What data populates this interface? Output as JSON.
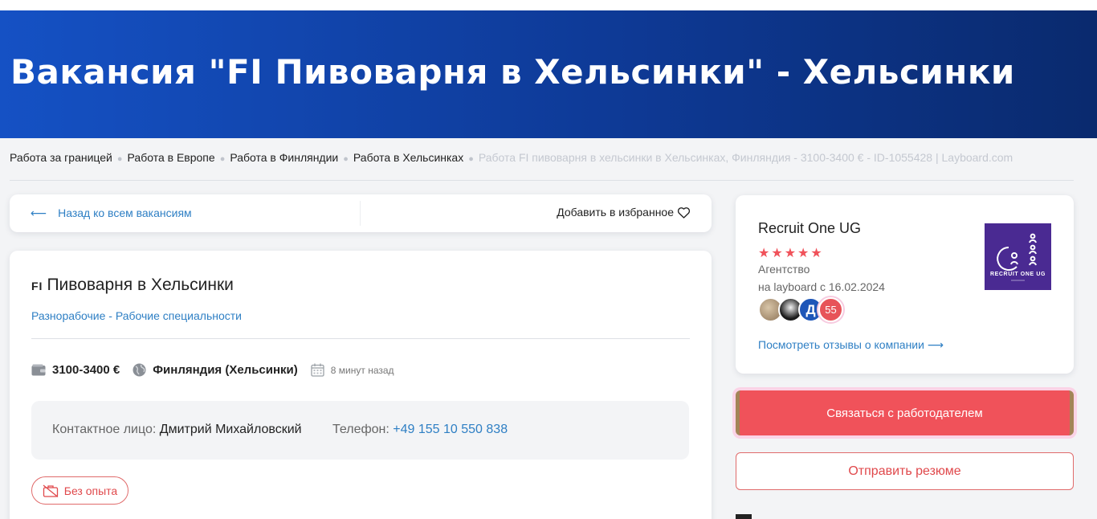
{
  "header": {
    "title": "Вакансия \"FI Пивоварня в Хельсинки\" - Хельсинки"
  },
  "breadcrumbs": {
    "items": [
      "Работа за границей",
      "Работа в Европе",
      "Работа в Финляндии",
      "Работа в Хельсинках"
    ],
    "current": "Работа FI пивоварня в хельсинки в Хельсинках, Финляндия - 3100-3400 € - ID-1055428 | Layboard.com"
  },
  "nav": {
    "back_label": "Назад ко всем вакансиям",
    "favorite_label": "Добавить в избранное"
  },
  "job": {
    "flag_code": "FI",
    "title": "Пивоварня в Хельсинки",
    "category": "Разнорабочие - Рабочие специальности",
    "salary": "3100-3400 €",
    "location": "Финляндия (Хельсинки)",
    "posted": "8 минут назад",
    "contact_label": "Контактное лицо:",
    "contact_name": "Дмитрий Михайловский",
    "phone_label": "Телефон:",
    "phone": "+49 155 10 550 838",
    "badge": "Без опыта"
  },
  "company": {
    "name": "Recruit One UG",
    "rating_stars": 5,
    "type": "Агентство",
    "since": "на layboard с 16.02.2024",
    "avatar_initial": "Д",
    "reviews_count": "55",
    "reviews_link": "Посмотреть отзывы о компании ⟶",
    "logo_text": "RECRUIT ONE UG"
  },
  "actions": {
    "contact_employer": "Связаться с работодателем",
    "send_resume": "Отправить резюме"
  },
  "colors": {
    "hero_start": "#1551c4",
    "hero_end": "#0a2a6e",
    "accent": "#f0525a",
    "link": "#2e7fc4"
  }
}
